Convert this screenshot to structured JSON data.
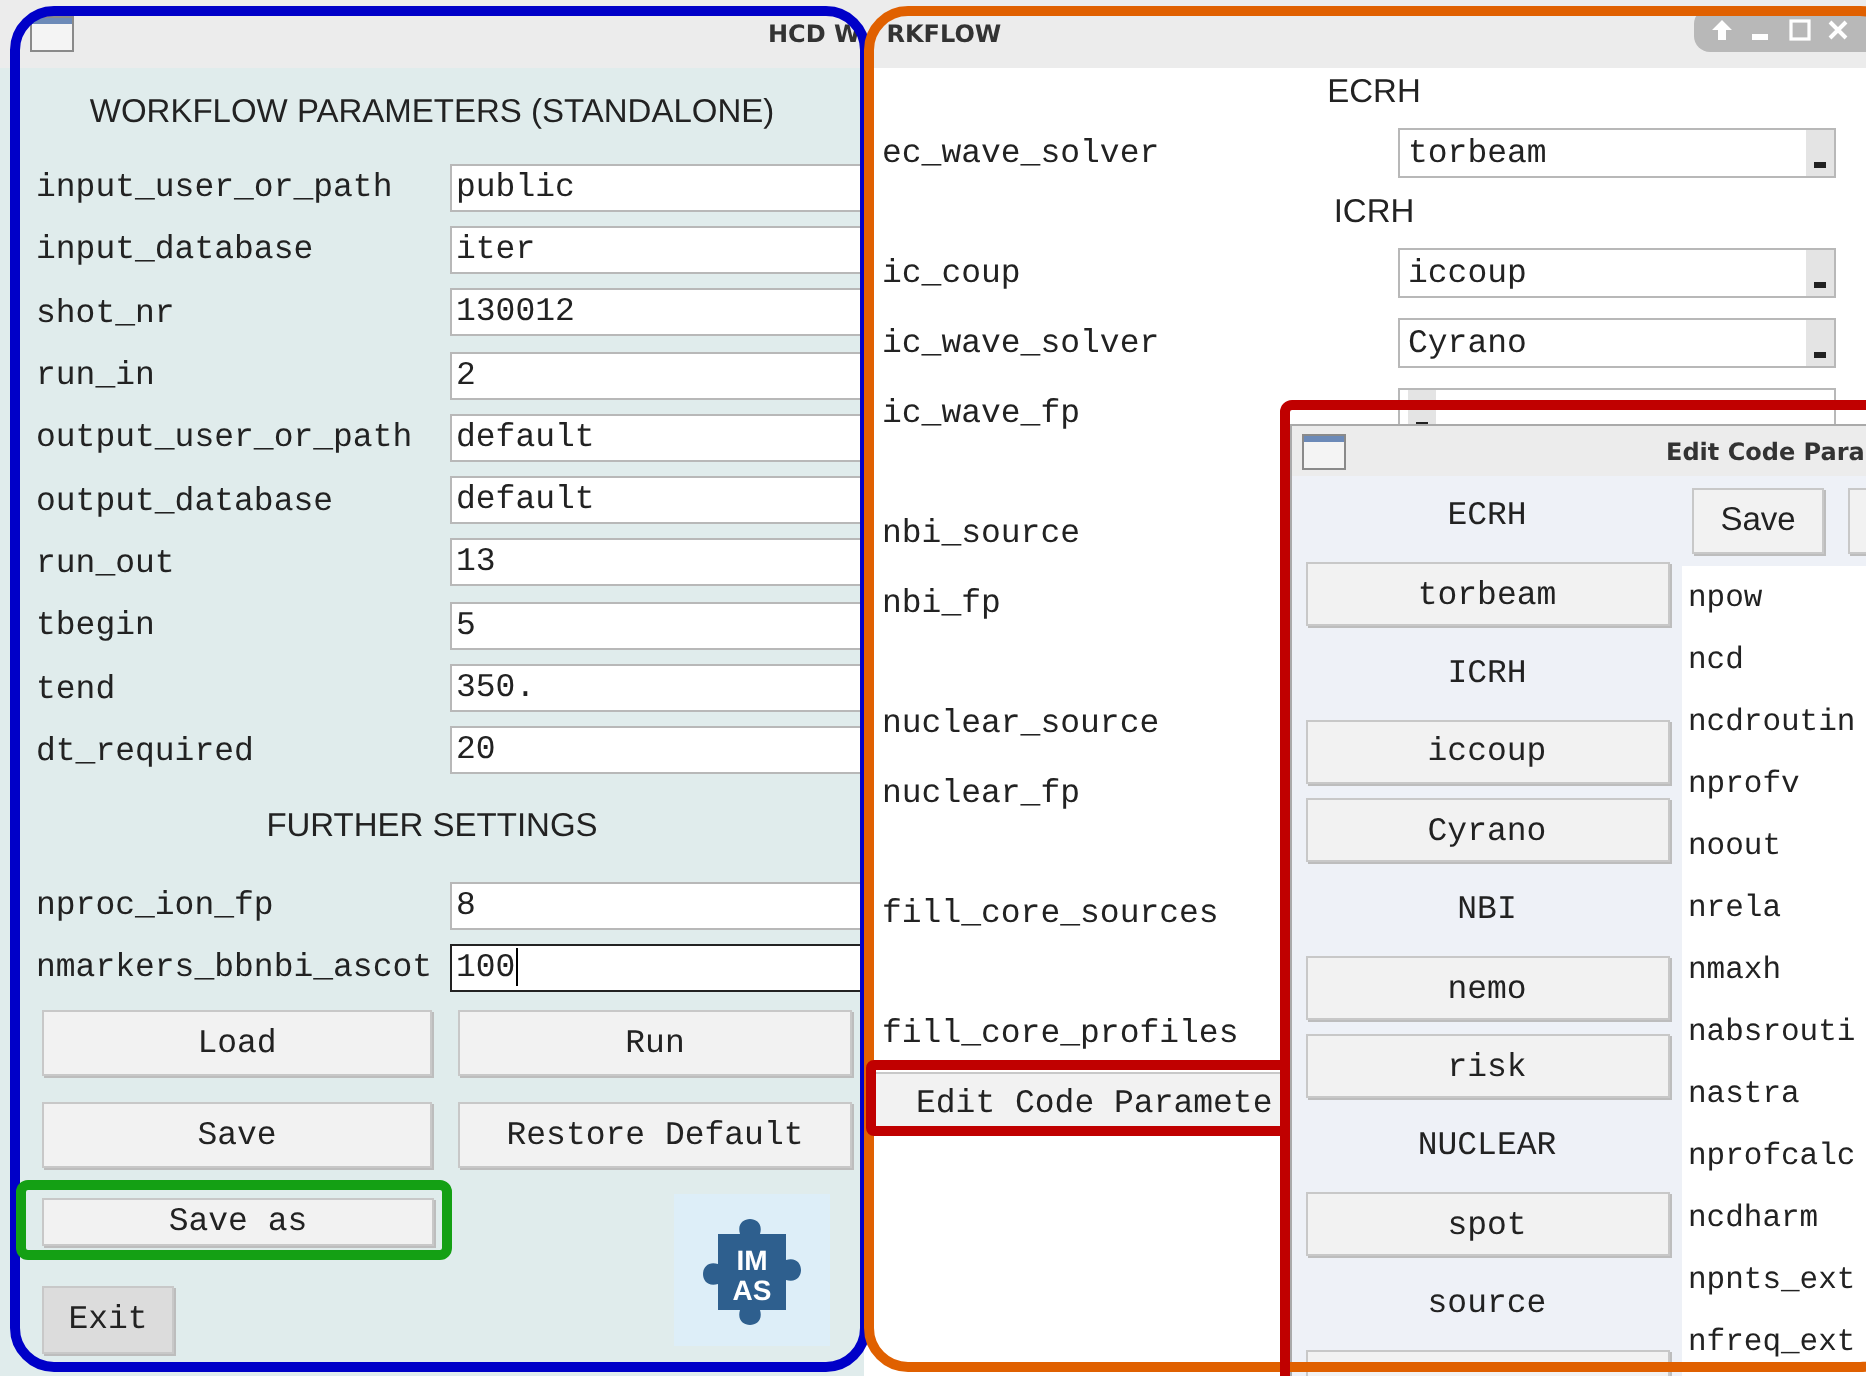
{
  "window": {
    "title_parts": [
      "HCD W",
      "RKFLOW"
    ]
  },
  "parameters": {
    "heading": "WORKFLOW PARAMETERS (STANDALONE)",
    "fields": [
      {
        "label": "input_user_or_path",
        "value": "public",
        "focused": false
      },
      {
        "label": "input_database",
        "value": "iter",
        "focused": false
      },
      {
        "label": "shot_nr",
        "value": "130012",
        "focused": false
      },
      {
        "label": "run_in",
        "value": "2",
        "focused": false
      },
      {
        "label": "output_user_or_path",
        "value": "default",
        "focused": false
      },
      {
        "label": "output_database",
        "value": "default",
        "focused": false
      },
      {
        "label": "run_out",
        "value": "13",
        "focused": false
      },
      {
        "label": "tbegin",
        "value": "5",
        "focused": false
      },
      {
        "label": "tend",
        "value": "350.",
        "focused": false
      },
      {
        "label": "dt_required",
        "value": "20",
        "focused": false
      }
    ]
  },
  "further_settings": {
    "heading": "FURTHER SETTINGS",
    "fields": [
      {
        "label": "nproc_ion_fp",
        "value": "8",
        "focused": false
      },
      {
        "label": "nmarkers_bbnbi_ascot",
        "value": "100",
        "focused": true
      }
    ]
  },
  "action_buttons": [
    "Load",
    "Run",
    "Save",
    "Restore Default"
  ],
  "save_as_button": "Save as",
  "exit_button": "Exit",
  "logo": {
    "lines": [
      "IM",
      "AS"
    ]
  },
  "solvers": {
    "sections": [
      {
        "title": "ECRH",
        "rows": [
          {
            "kind": "combo",
            "label": "ec_wave_solver",
            "value": "torbeam"
          }
        ]
      },
      {
        "title": "ICRH",
        "rows": [
          {
            "kind": "combo",
            "label": "ic_coup",
            "value": "iccoup"
          },
          {
            "kind": "combo",
            "label": "ic_wave_solver",
            "value": "Cyrano"
          },
          {
            "kind": "combo",
            "label": "ic_wave_fp"
          }
        ]
      },
      {
        "rows": [
          {
            "kind": "label",
            "label": "nbi_source"
          },
          {
            "kind": "label",
            "label": "nbi_fp"
          }
        ]
      },
      {
        "rows": [
          {
            "kind": "label",
            "label": "nuclear_source"
          },
          {
            "kind": "label",
            "label": "nuclear_fp"
          }
        ]
      },
      {
        "rows": [
          {
            "kind": "label",
            "label": "fill_core_sources"
          }
        ]
      },
      {
        "rows": [
          {
            "kind": "label",
            "label": "fill_core_profiles"
          }
        ]
      }
    ],
    "edit_button": "Edit Code Paramete"
  },
  "dialog": {
    "title": "Edit Code Para",
    "items": [
      {
        "kind": "header",
        "label": "ECRH"
      },
      {
        "kind": "button",
        "label": "torbeam"
      },
      {
        "kind": "header",
        "label": "ICRH"
      },
      {
        "kind": "button",
        "label": "iccoup"
      },
      {
        "kind": "button",
        "label": "Cyrano"
      },
      {
        "kind": "header",
        "label": "NBI"
      },
      {
        "kind": "button",
        "label": "nemo"
      },
      {
        "kind": "button",
        "label": "risk"
      },
      {
        "kind": "header",
        "label": "NUCLEAR"
      },
      {
        "kind": "button",
        "label": "spot"
      },
      {
        "kind": "header",
        "label": "source"
      },
      {
        "kind": "button"
      }
    ],
    "toolbar_buttons": [
      {
        "label": "Save"
      }
    ],
    "parameters": [
      "npow",
      "ncd",
      "ncdroutin",
      "nprofv",
      "noout",
      "nrela",
      "nmaxh",
      "nabsrouti",
      "nastra",
      "nprofcalc",
      "ncdharm",
      "npnts_ext",
      "nfreq_ext"
    ]
  }
}
